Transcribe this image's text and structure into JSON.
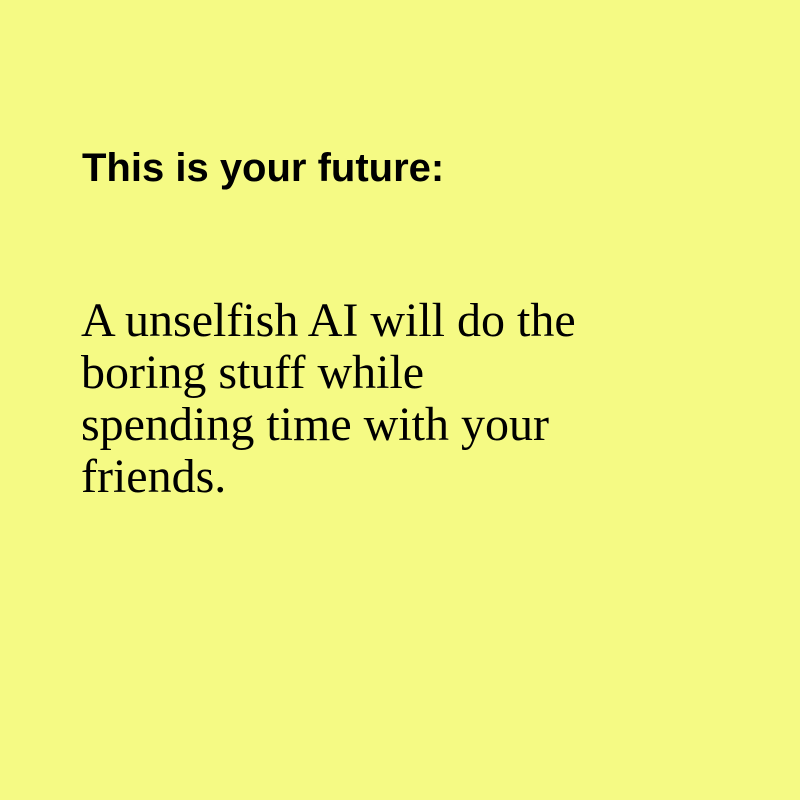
{
  "colors": {
    "background": "#f5fa84",
    "text": "#000000"
  },
  "headline": "This is your future:",
  "message": {
    "lines": [
      "A unselfish AI will do the",
      "boring stuff while",
      "spending time with your",
      "friends."
    ]
  }
}
